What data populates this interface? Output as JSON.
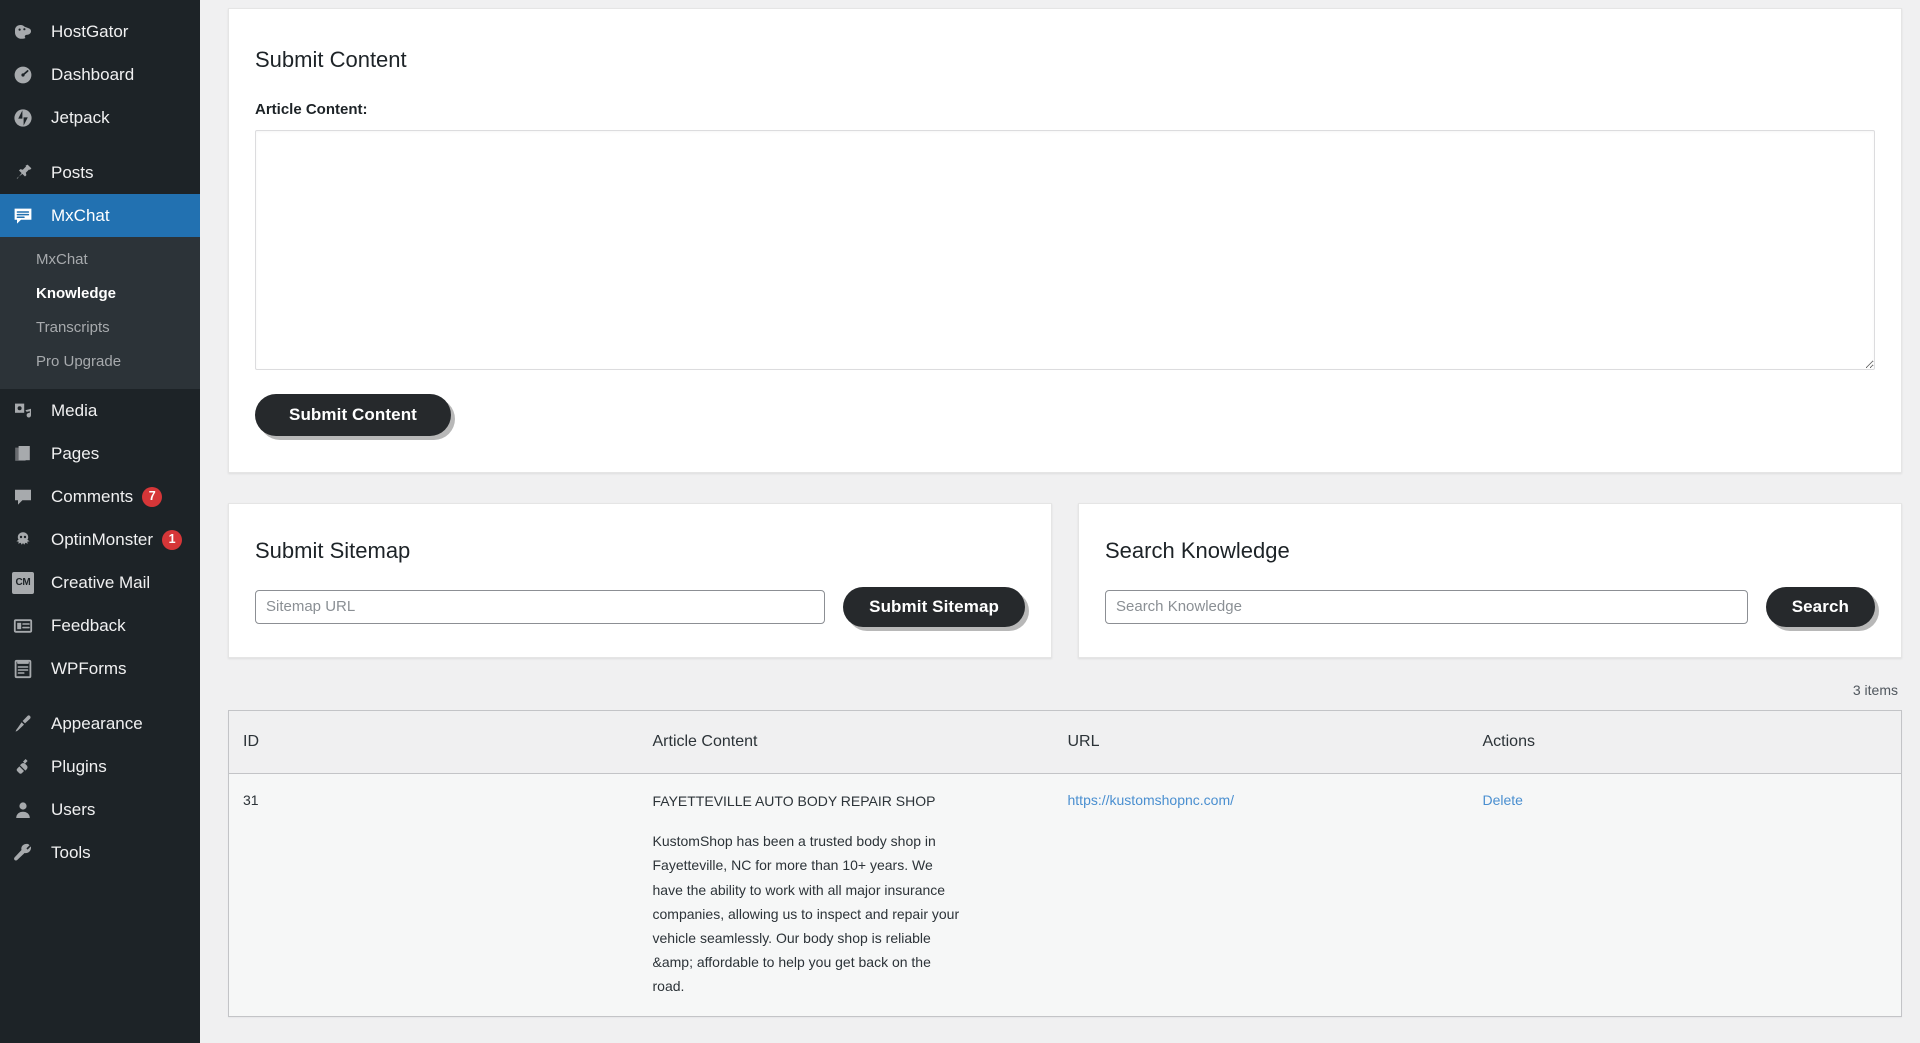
{
  "sidebar": {
    "items": [
      {
        "label": "HostGator",
        "icon": "hostgator-icon",
        "current": false
      },
      {
        "label": "Dashboard",
        "icon": "dashboard-icon",
        "current": false
      },
      {
        "label": "Jetpack",
        "icon": "jetpack-icon",
        "current": false
      },
      {
        "label": "Posts",
        "icon": "posts-pin-icon",
        "current": false
      },
      {
        "label": "MxChat",
        "icon": "mxchat-icon",
        "current": true
      },
      {
        "label": "Media",
        "icon": "media-icon",
        "current": false
      },
      {
        "label": "Pages",
        "icon": "pages-icon",
        "current": false
      },
      {
        "label": "Comments",
        "icon": "comments-icon",
        "current": false,
        "badge": "7"
      },
      {
        "label": "OptinMonster",
        "icon": "optinmonster-icon",
        "current": false,
        "badge": "1"
      },
      {
        "label": "Creative Mail",
        "icon": "creative-mail-icon",
        "current": false,
        "badge_text": "CM"
      },
      {
        "label": "Feedback",
        "icon": "feedback-icon",
        "current": false
      },
      {
        "label": "WPForms",
        "icon": "wpforms-icon",
        "current": false
      },
      {
        "label": "Appearance",
        "icon": "appearance-brush-icon",
        "current": false
      },
      {
        "label": "Plugins",
        "icon": "plugins-plug-icon",
        "current": false
      },
      {
        "label": "Users",
        "icon": "users-person-icon",
        "current": false
      },
      {
        "label": "Tools",
        "icon": "tools-wrench-icon",
        "current": false
      }
    ],
    "submenu": [
      {
        "label": "MxChat",
        "current": false
      },
      {
        "label": "Knowledge",
        "current": true
      },
      {
        "label": "Transcripts",
        "current": false
      },
      {
        "label": "Pro Upgrade",
        "current": false
      }
    ],
    "colors": {
      "background": "#1d2327",
      "submenu_background": "#2c3338",
      "current_accent": "#2271b1",
      "badge": "#d63638"
    }
  },
  "submit_content": {
    "title": "Submit Content",
    "field_label": "Article Content:",
    "textarea_value": "",
    "textarea_placeholder": "",
    "button_label": "Submit Content"
  },
  "submit_sitemap": {
    "title": "Submit Sitemap",
    "input_value": "",
    "input_placeholder": "Sitemap URL",
    "button_label": "Submit Sitemap"
  },
  "search_knowledge": {
    "title": "Search Knowledge",
    "input_value": "",
    "input_placeholder": "Search Knowledge",
    "button_label": "Search"
  },
  "table": {
    "items_count": "3 items",
    "columns": [
      "ID",
      "Article Content",
      "URL",
      "Actions"
    ],
    "rows": [
      {
        "id": "31",
        "article_title": "FAYETTEVILLE AUTO BODY REPAIR SHOP",
        "article_body": "KustomShop has been a trusted body shop in Fayetteville, NC for more than 10+ years. We have the ability to work with all major insurance companies, allowing us to inspect and repair your vehicle seamlessly. Our body shop is reliable &amp; affordable to help you get back on the road.",
        "url": "https://kustomshopnc.com/",
        "action_label": "Delete"
      }
    ],
    "link_color": "#4a8fd0"
  }
}
